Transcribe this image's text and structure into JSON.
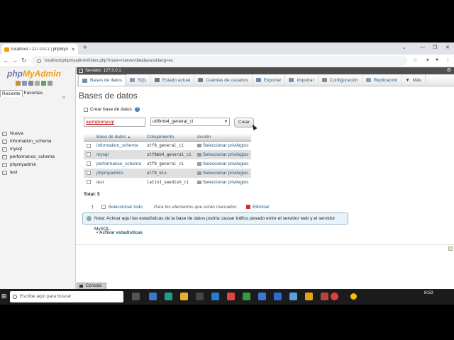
{
  "browser": {
    "tab_title": "localhost / 127.0.0.1 | phpMyAdm",
    "url": "localhost/phpmyadmin/index.php?route=/server/databases&lang=es",
    "win_min": "—",
    "win_max": "❐",
    "win_close": "✕"
  },
  "sidebar": {
    "logo_a": "php",
    "logo_b": "MyAdmin",
    "tab_recent": "Reciente",
    "tab_fav": "Favoritas",
    "link_icon": "∞",
    "tree": [
      "Nueva",
      "information_schema",
      "mysql",
      "performance_schema",
      "phpmyadmin",
      "test"
    ]
  },
  "main": {
    "server_label": "Servidor: 127.0.0.1",
    "tabs": [
      {
        "label": "Bases de datos",
        "icon": "database-icon",
        "color": "#6b8fb3"
      },
      {
        "label": "SQL",
        "icon": "sql-icon",
        "color": "#8a9bb0"
      },
      {
        "label": "Estado actual",
        "icon": "status-icon",
        "color": "#5a7d9a"
      },
      {
        "label": "Cuentas de usuarios",
        "icon": "users-icon",
        "color": "#6a7f95"
      },
      {
        "label": "Exportar",
        "icon": "export-icon",
        "color": "#6a8bb0"
      },
      {
        "label": "Importar",
        "icon": "import-icon",
        "color": "#7a8fa5"
      },
      {
        "label": "Configuración",
        "icon": "wrench-icon",
        "color": "#8a8a8a"
      },
      {
        "label": "Replicación",
        "icon": "replication-icon",
        "color": "#8aa0b0"
      },
      {
        "label": "Más",
        "icon": "menu-icon",
        "color": "#444444"
      }
    ],
    "title": "Bases de datos",
    "create_label": "Crear base de datos",
    "help": "?",
    "dbname_value": "ejemplomysql",
    "collation_value": "utf8mb4_general_ci",
    "create_button": "Crear",
    "table": {
      "headers": [
        "Base de datos",
        "Cotejamiento",
        "Acción"
      ],
      "sort_arrow": "▲",
      "rows": [
        {
          "name": "information_schema",
          "collation": "utf8_general_ci",
          "action": "Seleccionar privilegios"
        },
        {
          "name": "mysql",
          "collation": "utf8mb4_general_ci",
          "action": "Seleccionar privilegios"
        },
        {
          "name": "performance_schema",
          "collation": "utf8_general_ci",
          "action": "Seleccionar privilegios"
        },
        {
          "name": "phpmyadmin",
          "collation": "utf8_bin",
          "action": "Seleccionar privilegios"
        },
        {
          "name": "test",
          "collation": "latin1_swedish_ci",
          "action": "Seleccionar privilegios"
        }
      ]
    },
    "total": "Total: 5",
    "select_all": "Seleccionar todo",
    "with_selected": "Para los elementos que están marcados:",
    "delete": "Eliminar",
    "note": "Nota: Activar aquí las estadísticas de la base de datos podría causar tráfico pesado entre el servidor web y el servidor MySQL.",
    "activate_stats": "Activar estadísticas",
    "console": "Consola"
  },
  "taskbar": {
    "search_placeholder": "Escribe aquí para buscar",
    "clock": "8:50"
  },
  "colors": {
    "link": "#235a81",
    "server_bar": "#4f4f4f",
    "logo_blue": "#6c78af",
    "logo_orange": "#f29e0b"
  }
}
